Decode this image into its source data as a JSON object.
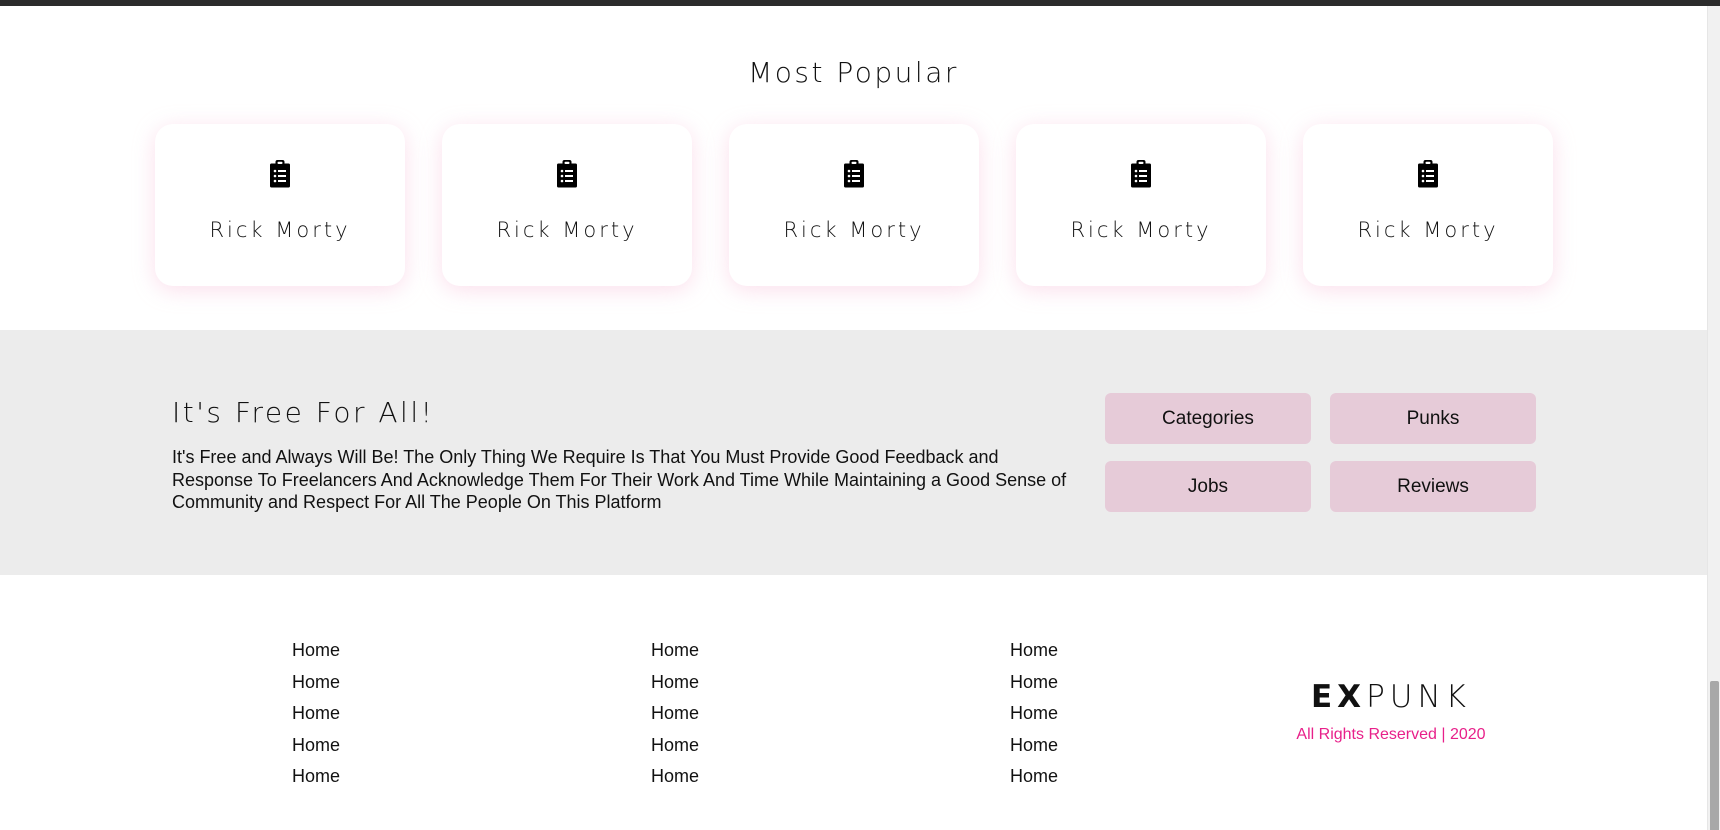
{
  "popular": {
    "title": "Most Popular",
    "icon": "clipboard-list-icon",
    "cards": [
      {
        "label": "Rick Morty"
      },
      {
        "label": "Rick Morty"
      },
      {
        "label": "Rick Morty"
      },
      {
        "label": "Rick Morty"
      },
      {
        "label": "Rick Morty"
      }
    ]
  },
  "free_section": {
    "title": "It's Free For All!",
    "text": "It's Free and Always Will Be! The Only Thing We Require Is That You Must Provide Good Feedback and Response To Freelancers And Acknowledge Them For Their Work And Time While Maintaining a Good Sense of Community and Respect For All The People On This Platform",
    "buttons": [
      {
        "label": "Categories"
      },
      {
        "label": "Punks"
      },
      {
        "label": "Jobs"
      },
      {
        "label": "Reviews"
      }
    ]
  },
  "footer": {
    "columns": [
      {
        "links": [
          "Home",
          "Home",
          "Home",
          "Home",
          "Home"
        ]
      },
      {
        "links": [
          "Home",
          "Home",
          "Home",
          "Home",
          "Home"
        ]
      },
      {
        "links": [
          "Home",
          "Home",
          "Home",
          "Home",
          "Home"
        ]
      }
    ],
    "logo": {
      "bold": "EX",
      "light": "PUNK"
    },
    "rights": "All Rights Reserved | 2020"
  },
  "colors": {
    "accent": "#e8208a",
    "button_bg": "#e6cbd8",
    "section_bg": "#ececec",
    "card_shadow": "#f5aacd"
  }
}
